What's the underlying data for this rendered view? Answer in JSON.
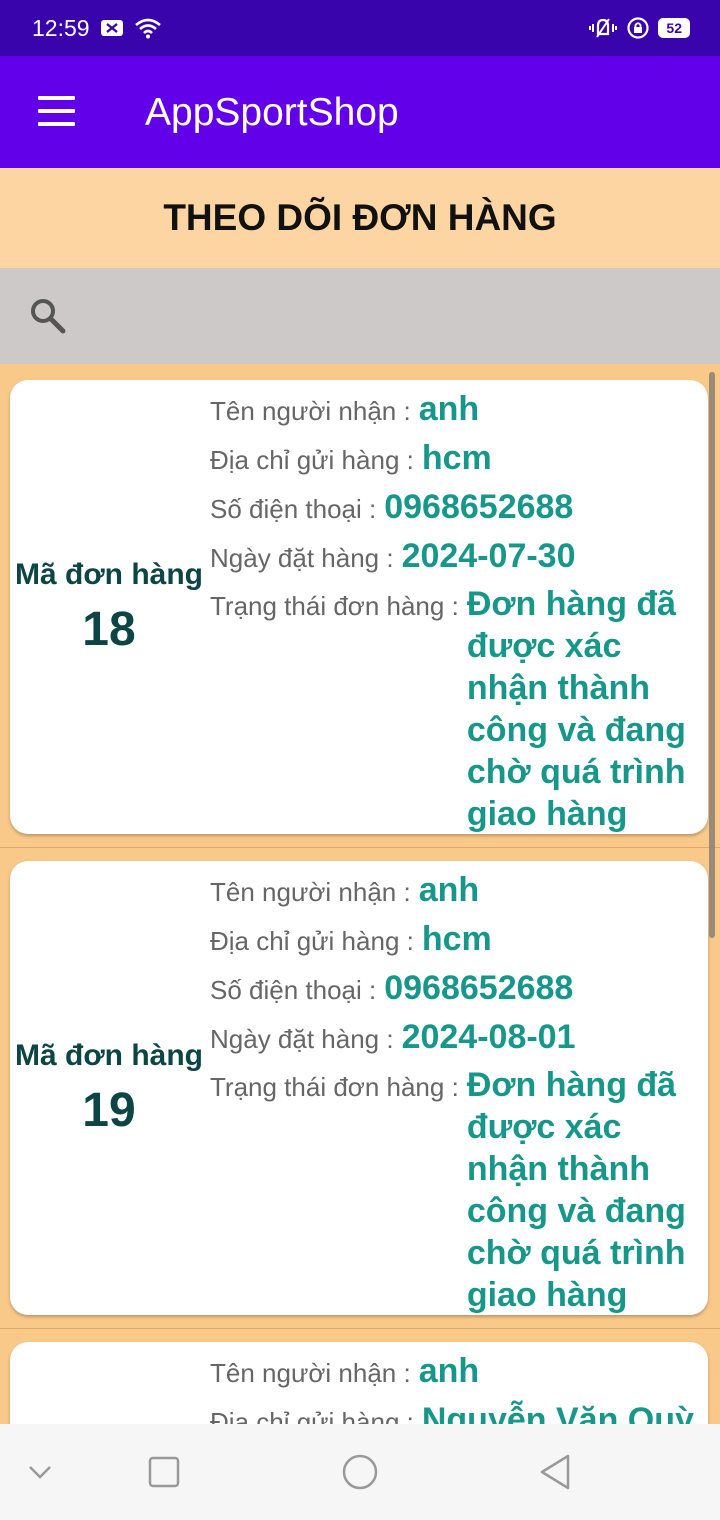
{
  "status_bar": {
    "time": "12:59",
    "battery": "52"
  },
  "app_bar": {
    "title": "AppSportShop"
  },
  "page": {
    "title": "THEO DÕI ĐƠN HÀNG"
  },
  "labels": {
    "order_code": "Mã đơn hàng",
    "receiver": "Tên người nhận :",
    "address": "Địa chỉ gửi hàng :",
    "phone": "Số điện thoại :",
    "order_date": "Ngày đặt hàng :",
    "status": "Trạng thái đơn hàng :"
  },
  "orders": [
    {
      "id": "18",
      "receiver": "anh",
      "address": "hcm",
      "phone": "0968652688",
      "date": "2024-07-30",
      "status": "Đơn hàng đã được xác nhận thành công và đang chờ quá trình giao hàng"
    },
    {
      "id": "19",
      "receiver": "anh",
      "address": "hcm",
      "phone": "0968652688",
      "date": "2024-08-01",
      "status": "Đơn hàng đã được xác nhận thành công và đang chờ quá trình giao hàng"
    },
    {
      "receiver": "anh",
      "address": "Nguyễn Văn Quỳ"
    }
  ],
  "colors": {
    "status_bar": "#3a04ad",
    "app_bar": "#6200ea",
    "header_bg": "#fdd5a3",
    "list_bg": "#f9c98a",
    "value_text": "#16978a",
    "code_text": "#0d4444"
  }
}
